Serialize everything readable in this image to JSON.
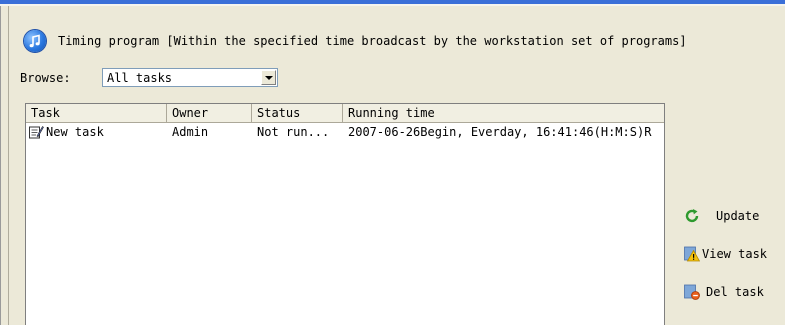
{
  "header": {
    "title": "Timing program [Within the specified time broadcast by the workstation set of programs]"
  },
  "browse": {
    "label": "Browse:",
    "selected": "All tasks"
  },
  "table": {
    "columns": [
      "Task",
      "Owner",
      "Status",
      "Running time"
    ],
    "rows": [
      {
        "task": "New task",
        "owner": "Admin",
        "status": "Not run...",
        "running_time": "2007-06-26Begin, Everday, 16:41:46(H:M:S)R"
      }
    ]
  },
  "actions": {
    "update": "Update",
    "view_task": "View task",
    "del_task": "Del task"
  },
  "icons": {
    "logo": "music-note-icon",
    "task": "task-icon",
    "update": "refresh-icon",
    "view": "warning-icon",
    "delete": "delete-icon"
  },
  "colors": {
    "accent": "#3a6fd8",
    "window_bg": "#ece9d8",
    "list_bg": "#ffffff"
  }
}
